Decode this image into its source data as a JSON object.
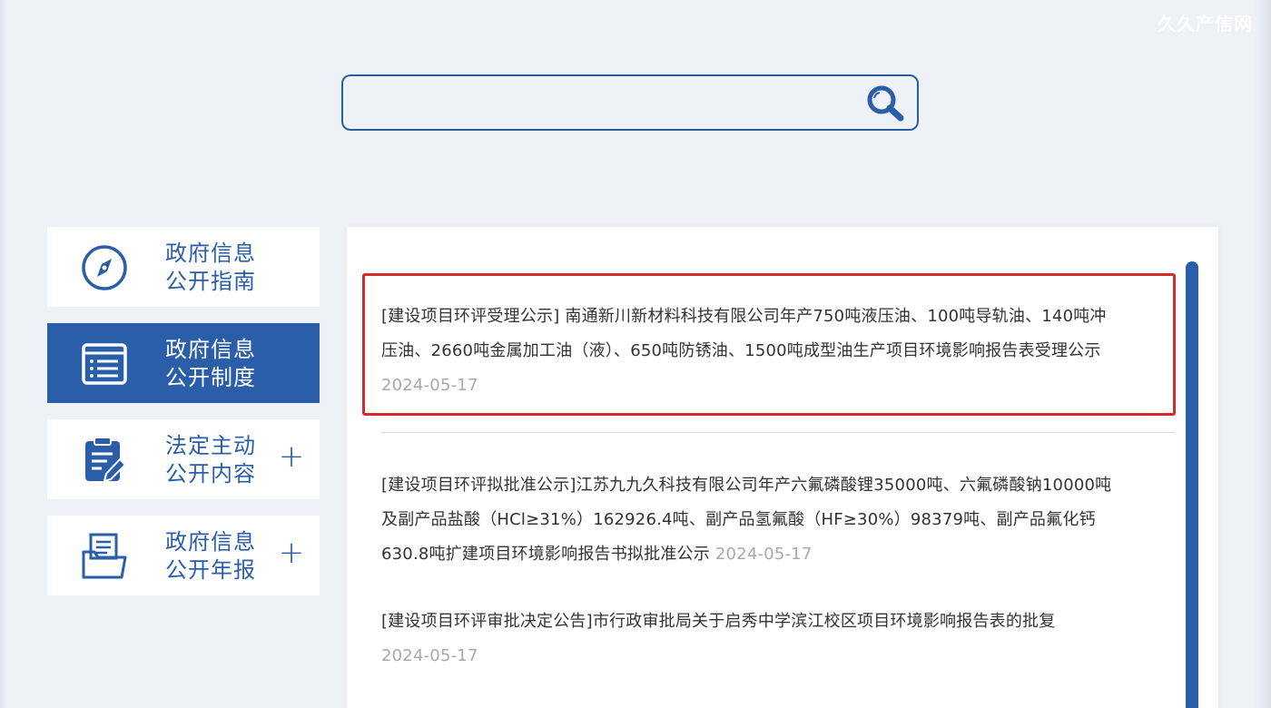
{
  "watermark": "久久产信网",
  "search": {
    "value": "",
    "placeholder": ""
  },
  "sidebar": {
    "items": [
      {
        "label_line1": "政府信息",
        "label_line2": "公开指南",
        "icon": "compass-icon",
        "active": false
      },
      {
        "label_line1": "政府信息",
        "label_line2": "公开制度",
        "icon": "document-list-icon",
        "active": true
      },
      {
        "label_line1": "法定主动",
        "label_line2": "公开内容",
        "icon": "clipboard-edit-icon",
        "active": false,
        "expand": "+"
      },
      {
        "label_line1": "政府信息",
        "label_line2": "公开年报",
        "icon": "folder-document-icon",
        "active": false,
        "expand": "+"
      }
    ]
  },
  "news": [
    {
      "line1": "[建设项目环评受理公示] 南通新川新材料科技有限公司年产750吨液压油、100吨导轨油、140吨冲",
      "line2": "压油、2660吨金属加工油（液）、650吨防锈油、1500吨成型油生产项目环境影响报告表受理公示",
      "date": "2024-05-17",
      "highlighted": true
    },
    {
      "line1": "[建设项目环评拟批准公示]江苏九九久科技有限公司年产六氟磷酸锂35000吨、六氟磷酸钠10000吨",
      "line2": "及副产品盐酸（HCl≥31%）162926.4吨、副产品氢氟酸（HF≥30%）98379吨、副产品氟化钙",
      "line3": "630.8吨扩建项目环境影响报告书拟批准公示",
      "date": "2024-05-17"
    },
    {
      "line1": "[建设项目环评审批决定公告]市行政审批局关于启秀中学滨江校区项目环境影响报告表的批复",
      "date": "2024-05-17"
    }
  ],
  "colors": {
    "brand_blue": "#2b5ea8",
    "highlight_red": "#d42b2b",
    "date_gray": "#a9a9a9",
    "background": "#eef1f6"
  }
}
